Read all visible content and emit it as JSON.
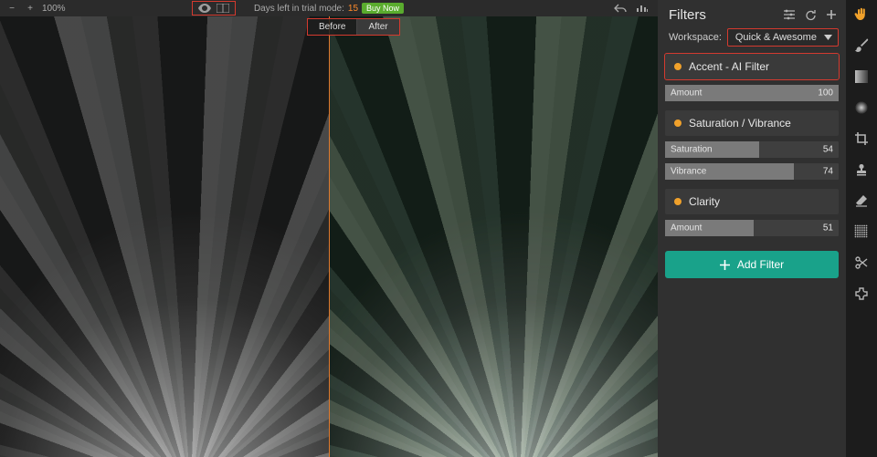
{
  "topbar": {
    "zoom_minus": "−",
    "zoom_plus": "+",
    "zoom_value": "100%",
    "trial_prefix": "Days left in trial mode:",
    "trial_days": "15",
    "buy_label": "Buy Now"
  },
  "compare": {
    "before_label": "Before",
    "after_label": "After"
  },
  "panel": {
    "title": "Filters",
    "workspace_label": "Workspace:",
    "workspace_value": "Quick & Awesome",
    "add_filter_label": "Add Filter"
  },
  "filters": [
    {
      "name": "Accent - AI Filter",
      "highlighted": true,
      "sliders": [
        {
          "label": "Amount",
          "value": 100
        }
      ]
    },
    {
      "name": "Saturation / Vibrance",
      "highlighted": false,
      "sliders": [
        {
          "label": "Saturation",
          "value": 54
        },
        {
          "label": "Vibrance",
          "value": 74
        }
      ]
    },
    {
      "name": "Clarity",
      "highlighted": false,
      "sliders": [
        {
          "label": "Amount",
          "value": 51
        }
      ]
    }
  ],
  "tools": [
    {
      "name": "hand-tool-icon",
      "active": true
    },
    {
      "name": "brush-tool-icon",
      "active": false
    },
    {
      "name": "gradient-tool-icon",
      "active": false
    },
    {
      "name": "radial-tool-icon",
      "active": false
    },
    {
      "name": "crop-tool-icon",
      "active": false
    },
    {
      "name": "stamp-tool-icon",
      "active": false
    },
    {
      "name": "eraser-tool-icon",
      "active": false
    },
    {
      "name": "denoise-tool-icon",
      "active": false
    },
    {
      "name": "scissors-tool-icon",
      "active": false
    },
    {
      "name": "plugin-tool-icon",
      "active": false
    }
  ]
}
